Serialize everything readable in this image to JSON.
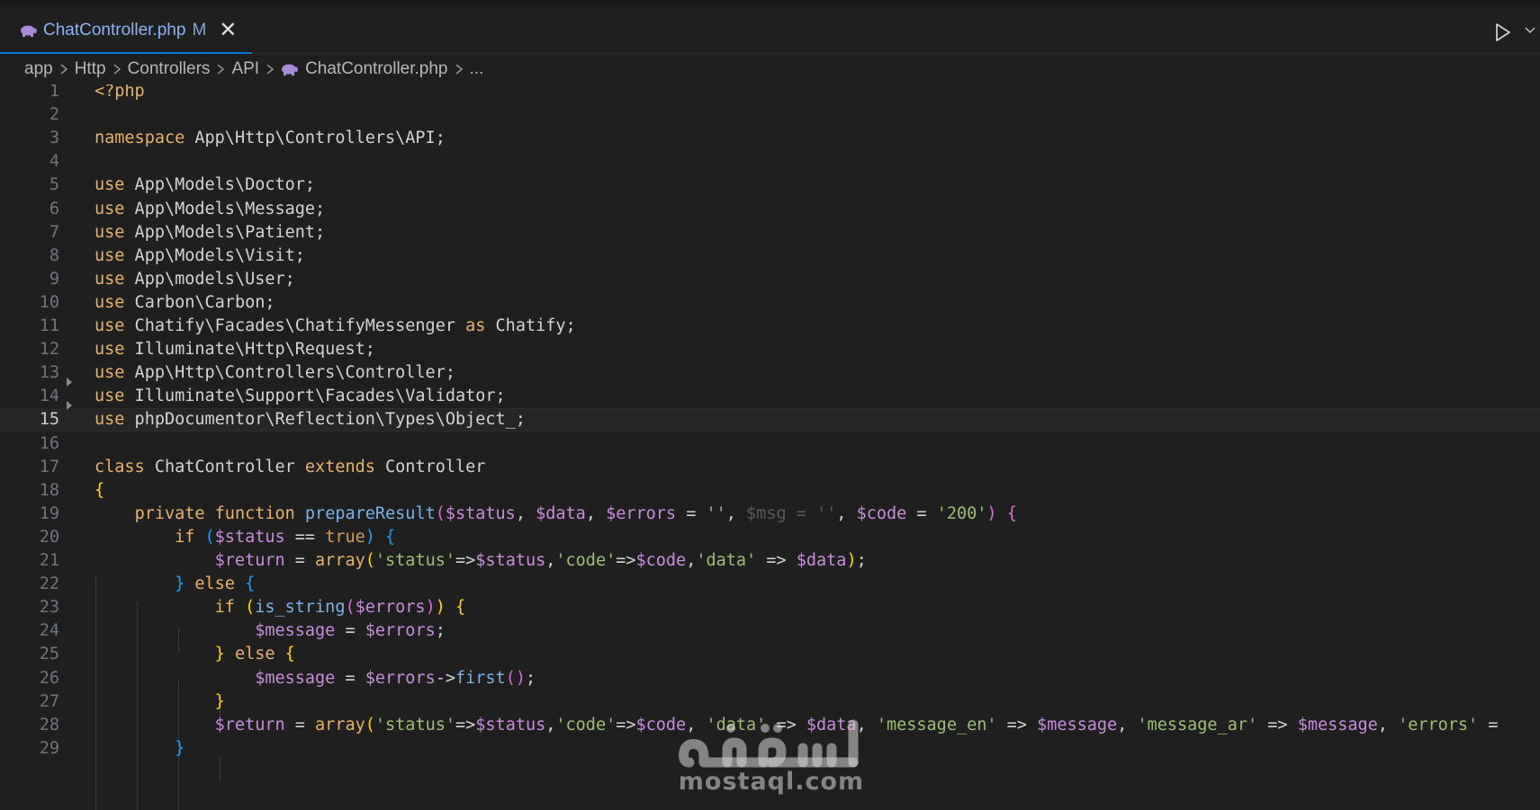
{
  "tab": {
    "label": "ChatController.php",
    "modified": "M",
    "close_glyph": "✕"
  },
  "breadcrumb": [
    "app",
    "Http",
    "Controllers",
    "API",
    "ChatController.php",
    "..."
  ],
  "editor": {
    "current_line": 15,
    "lines": [
      {
        "n": "1",
        "segs": [
          [
            "<?php",
            "k"
          ]
        ]
      },
      {
        "n": "2",
        "segs": []
      },
      {
        "n": "3",
        "segs": [
          [
            "namespace",
            "k"
          ],
          [
            " App\\Http\\Controllers\\API;",
            "t"
          ]
        ]
      },
      {
        "n": "4",
        "segs": []
      },
      {
        "n": "5",
        "segs": [
          [
            "use",
            "k"
          ],
          [
            " App\\Models\\Doctor;",
            "t"
          ]
        ]
      },
      {
        "n": "6",
        "segs": [
          [
            "use",
            "k"
          ],
          [
            " App\\Models\\Message;",
            "t"
          ]
        ]
      },
      {
        "n": "7",
        "segs": [
          [
            "use",
            "k"
          ],
          [
            " App\\Models\\Patient;",
            "t"
          ]
        ]
      },
      {
        "n": "8",
        "segs": [
          [
            "use",
            "k"
          ],
          [
            " App\\Models\\Visit;",
            "t"
          ]
        ]
      },
      {
        "n": "9",
        "segs": [
          [
            "use",
            "k"
          ],
          [
            " App\\models\\User;",
            "t"
          ]
        ]
      },
      {
        "n": "10",
        "segs": [
          [
            "use",
            "k"
          ],
          [
            " Carbon\\Carbon;",
            "t"
          ]
        ]
      },
      {
        "n": "11",
        "segs": [
          [
            "use",
            "k"
          ],
          [
            " Chatify\\Facades\\ChatifyMessenger ",
            "t"
          ],
          [
            "as",
            "k"
          ],
          [
            " Chatify;",
            "t"
          ]
        ]
      },
      {
        "n": "12",
        "segs": [
          [
            "use",
            "k"
          ],
          [
            " Illuminate\\Http\\Request;",
            "t"
          ]
        ]
      },
      {
        "n": "13",
        "segs": [
          [
            "use",
            "k"
          ],
          [
            " App\\Http\\Controllers\\Controller;",
            "t"
          ]
        ]
      },
      {
        "n": "14",
        "segs": [
          [
            "use",
            "k"
          ],
          [
            " Illuminate\\Support\\Facades\\Validator;",
            "t"
          ]
        ]
      },
      {
        "n": "15",
        "segs": [
          [
            "use",
            "k"
          ],
          [
            " phpDocumentor\\Reflection\\Types\\Object_;",
            "t"
          ]
        ]
      },
      {
        "n": "16",
        "segs": []
      },
      {
        "n": "17",
        "segs": [
          [
            "class",
            "k"
          ],
          [
            " ChatController ",
            "t"
          ],
          [
            "extends",
            "k"
          ],
          [
            " Controller",
            "t"
          ]
        ]
      },
      {
        "n": "18",
        "segs": [
          [
            "{",
            "b1"
          ]
        ]
      },
      {
        "n": "19",
        "segs": [
          [
            "    ",
            "t"
          ],
          [
            "private",
            "k"
          ],
          [
            " ",
            "t"
          ],
          [
            "function",
            "k"
          ],
          [
            " ",
            "t"
          ],
          [
            "prepareResult",
            "f"
          ],
          [
            "(",
            "b2"
          ],
          [
            "$status",
            "v"
          ],
          [
            ", ",
            "t"
          ],
          [
            "$data",
            "v"
          ],
          [
            ", ",
            "t"
          ],
          [
            "$errors",
            "v"
          ],
          [
            " = ",
            "t"
          ],
          [
            "''",
            "s"
          ],
          [
            ", ",
            "t"
          ],
          [
            "$msg = ''",
            "dim"
          ],
          [
            ", ",
            "t"
          ],
          [
            "$code",
            "v"
          ],
          [
            " = ",
            "t"
          ],
          [
            "'200'",
            "s"
          ],
          [
            ")",
            "b2"
          ],
          [
            " ",
            "t"
          ],
          [
            "{",
            "b2"
          ]
        ]
      },
      {
        "n": "20",
        "segs": [
          [
            "        ",
            "t"
          ],
          [
            "if",
            "k"
          ],
          [
            " ",
            "t"
          ],
          [
            "(",
            "b3"
          ],
          [
            "$status",
            "v"
          ],
          [
            " == ",
            "t"
          ],
          [
            "true",
            "kc"
          ],
          [
            ")",
            "b3"
          ],
          [
            " ",
            "t"
          ],
          [
            "{",
            "b3"
          ]
        ]
      },
      {
        "n": "21",
        "segs": [
          [
            "            ",
            "t"
          ],
          [
            "$return",
            "v"
          ],
          [
            " = ",
            "t"
          ],
          [
            "array",
            "k"
          ],
          [
            "(",
            "b1"
          ],
          [
            "'status'",
            "s"
          ],
          [
            "=>",
            "t"
          ],
          [
            "$status",
            "v"
          ],
          [
            ",",
            "t"
          ],
          [
            "'code'",
            "s"
          ],
          [
            "=>",
            "t"
          ],
          [
            "$code",
            "v"
          ],
          [
            ",",
            "t"
          ],
          [
            "'data'",
            "s"
          ],
          [
            " => ",
            "t"
          ],
          [
            "$data",
            "v"
          ],
          [
            ")",
            "b1"
          ],
          [
            ";",
            "t"
          ]
        ]
      },
      {
        "n": "22",
        "segs": [
          [
            "        ",
            "t"
          ],
          [
            "}",
            "b3"
          ],
          [
            " ",
            "t"
          ],
          [
            "else",
            "k"
          ],
          [
            " ",
            "t"
          ],
          [
            "{",
            "b3"
          ]
        ]
      },
      {
        "n": "23",
        "segs": [
          [
            "            ",
            "t"
          ],
          [
            "if",
            "k"
          ],
          [
            " ",
            "t"
          ],
          [
            "(",
            "b1"
          ],
          [
            "is_string",
            "f"
          ],
          [
            "(",
            "b2"
          ],
          [
            "$errors",
            "v"
          ],
          [
            ")",
            "b2"
          ],
          [
            ")",
            "b1"
          ],
          [
            " ",
            "t"
          ],
          [
            "{",
            "b1"
          ]
        ]
      },
      {
        "n": "24",
        "segs": [
          [
            "                ",
            "t"
          ],
          [
            "$message",
            "v"
          ],
          [
            " = ",
            "t"
          ],
          [
            "$errors",
            "v"
          ],
          [
            ";",
            "t"
          ]
        ]
      },
      {
        "n": "25",
        "segs": [
          [
            "            ",
            "t"
          ],
          [
            "}",
            "b1"
          ],
          [
            " ",
            "t"
          ],
          [
            "else",
            "k"
          ],
          [
            " ",
            "t"
          ],
          [
            "{",
            "b1"
          ]
        ]
      },
      {
        "n": "26",
        "segs": [
          [
            "                ",
            "t"
          ],
          [
            "$message",
            "v"
          ],
          [
            " = ",
            "t"
          ],
          [
            "$errors",
            "v"
          ],
          [
            "->",
            "t"
          ],
          [
            "first",
            "f"
          ],
          [
            "(",
            "b2"
          ],
          [
            ")",
            "b2"
          ],
          [
            ";",
            "t"
          ]
        ]
      },
      {
        "n": "27",
        "segs": [
          [
            "            ",
            "t"
          ],
          [
            "}",
            "b1"
          ]
        ]
      },
      {
        "n": "28",
        "segs": [
          [
            "            ",
            "t"
          ],
          [
            "$return",
            "v"
          ],
          [
            " = ",
            "t"
          ],
          [
            "array",
            "k"
          ],
          [
            "(",
            "b1"
          ],
          [
            "'status'",
            "s"
          ],
          [
            "=>",
            "t"
          ],
          [
            "$status",
            "v"
          ],
          [
            ",",
            "t"
          ],
          [
            "'code'",
            "s"
          ],
          [
            "=>",
            "t"
          ],
          [
            "$code",
            "v"
          ],
          [
            ", ",
            "t"
          ],
          [
            "'data'",
            "s"
          ],
          [
            " => ",
            "t"
          ],
          [
            "$data",
            "v"
          ],
          [
            ", ",
            "t"
          ],
          [
            "'message_en'",
            "s"
          ],
          [
            " => ",
            "t"
          ],
          [
            "$message",
            "v"
          ],
          [
            ", ",
            "t"
          ],
          [
            "'message_ar'",
            "s"
          ],
          [
            " => ",
            "t"
          ],
          [
            "$message",
            "v"
          ],
          [
            ", ",
            "t"
          ],
          [
            "'errors'",
            "s"
          ],
          [
            " =",
            "t"
          ]
        ]
      },
      {
        "n": "29",
        "segs": [
          [
            "        ",
            "t"
          ],
          [
            "}",
            "b3"
          ]
        ]
      }
    ],
    "fold_lines": [
      14,
      15
    ]
  },
  "watermark": {
    "logo_text": "مستقل",
    "domain": "mostaql.com"
  }
}
